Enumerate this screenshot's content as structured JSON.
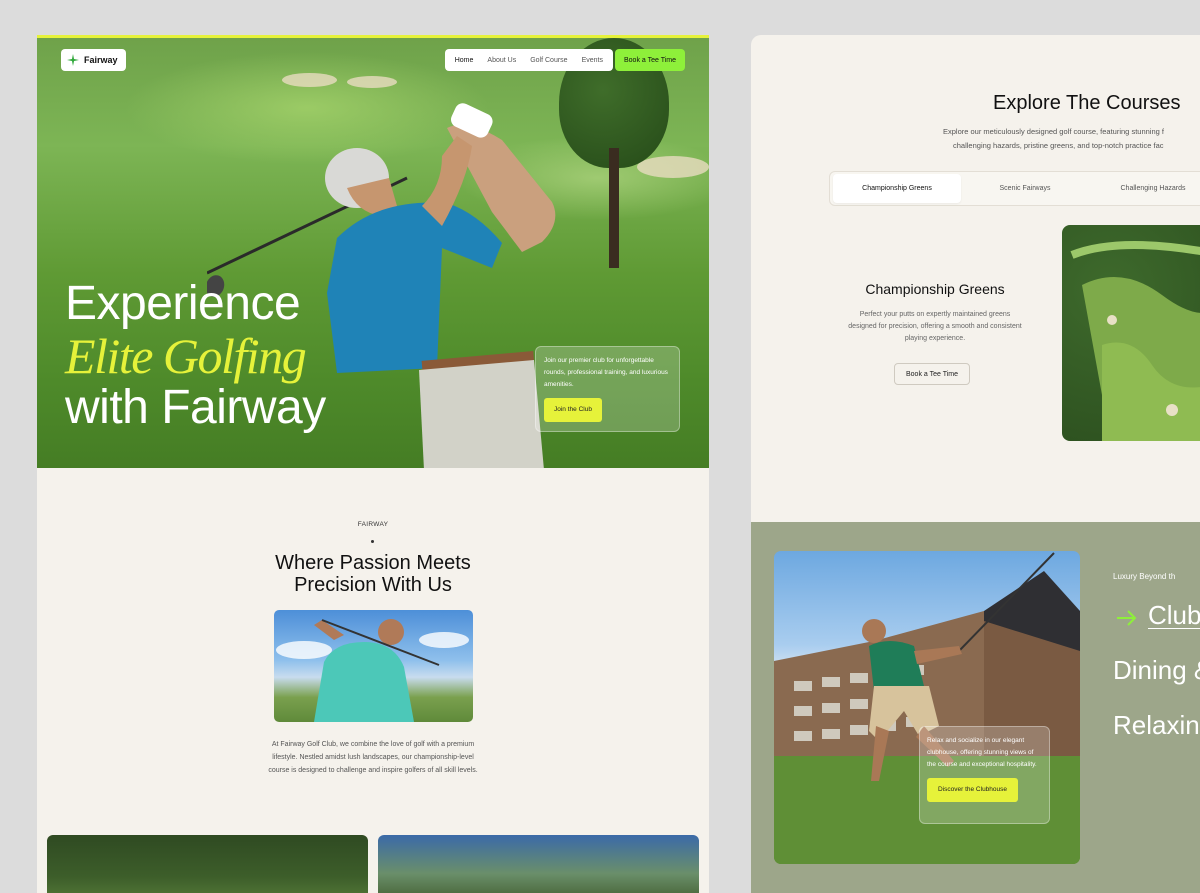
{
  "left": {
    "logo": "Fairway",
    "nav": [
      "Home",
      "About Us",
      "Golf Course",
      "Events"
    ],
    "nav_cta": "Book a Tee Time",
    "hero_line1": "Experience",
    "hero_line2": "Elite Golfing",
    "hero_line3": "with Fairway",
    "hero_box_text": "Join our premier club for unforgettable rounds, professional training, and luxurious amenities.",
    "hero_box_btn": "Join the Club",
    "about_eyebrow": "FAIRWAY",
    "about_title_1": "Where Passion Meets",
    "about_title_2": "Precision With Us",
    "about_text": "At Fairway Golf Club, we combine the love of golf with a premium lifestyle. Nestled amidst lush landscapes, our championship-level course is designed to challenge and inspire golfers of all skill levels."
  },
  "right": {
    "title": "Explore The Courses",
    "desc_1": "Explore our meticulously designed golf course, featuring stunning f",
    "desc_2": "challenging hazards, pristine greens, and top-notch practice fac",
    "tabs": [
      "Championship Greens",
      "Scenic Fairways",
      "Challenging Hazards"
    ],
    "course_title": "Championship Greens",
    "course_desc": "Perfect your putts on expertly maintained greens designed for precision, offering a smooth and consistent playing experience.",
    "course_btn": "Book a Tee Time",
    "club_eyebrow": "Luxury Beyond th",
    "club_items": [
      "Club",
      "Dining &",
      "Relaxin"
    ],
    "club_box_text": "Relax and socialize in our elegant clubhouse, offering stunning views of the course and exceptional hospitality.",
    "club_box_btn": "Discover the Clubhouse"
  },
  "colors": {
    "accent_yellow": "#e6f23a",
    "accent_green": "#8ef03a",
    "club_bg": "#9da68a",
    "page_bg": "#dcdcdc",
    "card_bg": "#f5f2ec"
  },
  "icons": [
    "sparkle-logo-icon",
    "arrow-right-icon"
  ]
}
